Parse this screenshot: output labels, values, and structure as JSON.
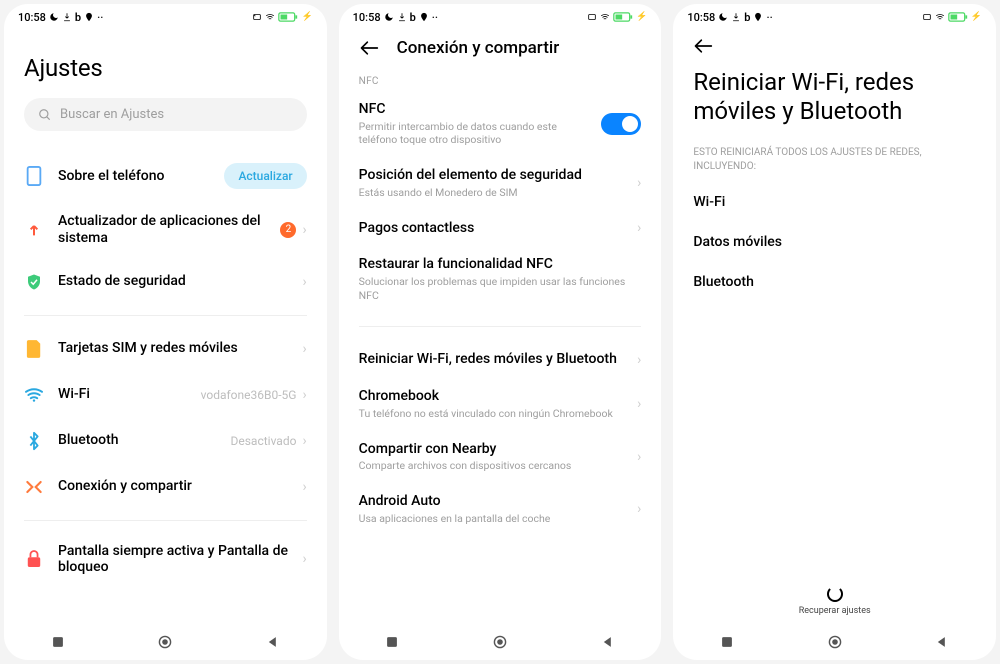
{
  "status": {
    "time": "10:58",
    "left_icons": [
      "moon",
      "down",
      "b",
      "loc",
      "dots"
    ],
    "right_icons": [
      "card",
      "wifi",
      "battery",
      "bolt"
    ]
  },
  "screen1": {
    "title": "Ajustes",
    "search_placeholder": "Buscar en Ajustes",
    "rows": {
      "about": {
        "label": "Sobre el teléfono",
        "action": "Actualizar"
      },
      "updater": {
        "label": "Actualizador de aplicaciones del sistema",
        "badge": "2"
      },
      "security": {
        "label": "Estado de seguridad"
      },
      "sim": {
        "label": "Tarjetas SIM y redes móviles"
      },
      "wifi": {
        "label": "Wi-Fi",
        "value": "vodafone36B0-5G"
      },
      "bluetooth": {
        "label": "Bluetooth",
        "value": "Desactivado"
      },
      "share": {
        "label": "Conexión y compartir"
      },
      "lockscreen": {
        "label": "Pantalla siempre activa y Pantalla de bloqueo"
      }
    }
  },
  "screen2": {
    "header": "Conexión y compartir",
    "section_nfc": "NFC",
    "rows": {
      "nfc": {
        "label": "NFC",
        "sub": "Permitir intercambio de datos cuando este teléfono toque otro dispositivo"
      },
      "sec_pos": {
        "label": "Posición del elemento de seguridad",
        "sub": "Estás usando el Monedero de SIM"
      },
      "contactless": {
        "label": "Pagos contactless"
      },
      "restore_nfc": {
        "label": "Restaurar la funcionalidad NFC",
        "sub": "Solucionar los problemas que impiden usar las funciones NFC"
      },
      "reset": {
        "label": "Reiniciar Wi-Fi, redes móviles y Bluetooth"
      },
      "chromebook": {
        "label": "Chromebook",
        "sub": "Tu teléfono no está vinculado con ningún Chromebook"
      },
      "nearby": {
        "label": "Compartir con Nearby",
        "sub": "Comparte archivos con dispositivos cercanos"
      },
      "aauto": {
        "label": "Android Auto",
        "sub": "Usa aplicaciones en la pantalla del coche"
      }
    }
  },
  "screen3": {
    "title": "Reiniciar Wi-Fi, redes móviles y Bluetooth",
    "subtitle": "ESTO REINICIARÁ TODOS LOS AJUSTES DE REDES, INCLUYENDO:",
    "items": {
      "wifi": "Wi-Fi",
      "mobile": "Datos móviles",
      "bt": "Bluetooth"
    },
    "button": "Recuperar ajustes"
  }
}
